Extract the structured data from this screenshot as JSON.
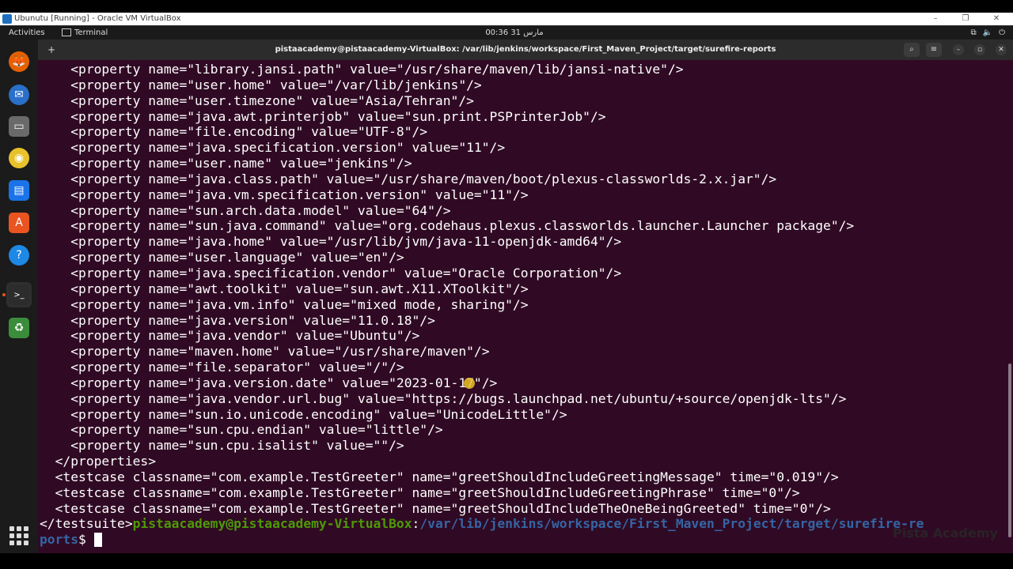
{
  "vbox": {
    "title": "Ubunutu [Running] - Oracle VM VirtualBox",
    "minimize": "–",
    "maximize": "❐",
    "close": "✕"
  },
  "topbar": {
    "activities": "Activities",
    "app_name": "Terminal",
    "clock": "00:36  مارس 31",
    "tray_network": "⧉",
    "tray_volume": "🔈",
    "tray_power": "⏻"
  },
  "dock": {
    "items": [
      {
        "name": "firefox",
        "glyph": "🦊",
        "color": "#e66000"
      },
      {
        "name": "thunderbird",
        "glyph": "✉",
        "color": "#2a6fc9"
      },
      {
        "name": "files",
        "glyph": "▭",
        "color": "#6a6a6a"
      },
      {
        "name": "rhythmbox",
        "glyph": "◉",
        "color": "#e8c22c"
      },
      {
        "name": "writer",
        "glyph": "▤",
        "color": "#1a73e8"
      },
      {
        "name": "software",
        "glyph": "A",
        "color": "#e95420"
      },
      {
        "name": "help",
        "glyph": "?",
        "color": "#1e88e5"
      },
      {
        "name": "terminal",
        "glyph": ">_",
        "color": "#2c2c2c"
      },
      {
        "name": "trash",
        "glyph": "♻",
        "color": "#3b8c3b"
      }
    ]
  },
  "terminal": {
    "title": "pistaacademy@pistaacademy-VirtualBox: /var/lib/jenkins/workspace/First_Maven_Project/target/surefire-reports",
    "new_tab": "+",
    "search": "⌕",
    "menu": "≡",
    "minimize": "–",
    "maximize": "▫",
    "close": "✕",
    "lines": [
      "    <property name=\"library.jansi.path\" value=\"/usr/share/maven/lib/jansi-native\"/>",
      "    <property name=\"user.home\" value=\"/var/lib/jenkins\"/>",
      "    <property name=\"user.timezone\" value=\"Asia/Tehran\"/>",
      "    <property name=\"java.awt.printerjob\" value=\"sun.print.PSPrinterJob\"/>",
      "    <property name=\"file.encoding\" value=\"UTF-8\"/>",
      "    <property name=\"java.specification.version\" value=\"11\"/>",
      "    <property name=\"user.name\" value=\"jenkins\"/>",
      "    <property name=\"java.class.path\" value=\"/usr/share/maven/boot/plexus-classworlds-2.x.jar\"/>",
      "    <property name=\"java.vm.specification.version\" value=\"11\"/>",
      "    <property name=\"sun.arch.data.model\" value=\"64\"/>",
      "    <property name=\"sun.java.command\" value=\"org.codehaus.plexus.classworlds.launcher.Launcher package\"/>",
      "    <property name=\"java.home\" value=\"/usr/lib/jvm/java-11-openjdk-amd64\"/>",
      "    <property name=\"user.language\" value=\"en\"/>",
      "    <property name=\"java.specification.vendor\" value=\"Oracle Corporation\"/>",
      "    <property name=\"awt.toolkit\" value=\"sun.awt.X11.XToolkit\"/>",
      "    <property name=\"java.vm.info\" value=\"mixed mode, sharing\"/>",
      "    <property name=\"java.version\" value=\"11.0.18\"/>",
      "    <property name=\"java.vendor\" value=\"Ubuntu\"/>",
      "    <property name=\"maven.home\" value=\"/usr/share/maven\"/>",
      "    <property name=\"file.separator\" value=\"/\"/>",
      "    <property name=\"java.version.date\" value=\"2023-01-17\"/>",
      "    <property name=\"java.vendor.url.bug\" value=\"https://bugs.launchpad.net/ubuntu/+source/openjdk-lts\"/>",
      "    <property name=\"sun.io.unicode.encoding\" value=\"UnicodeLittle\"/>",
      "    <property name=\"sun.cpu.endian\" value=\"little\"/>",
      "    <property name=\"sun.cpu.isalist\" value=\"\"/>",
      "  </properties>",
      "  <testcase classname=\"com.example.TestGreeter\" name=\"greetShouldIncludeGreetingMessage\" time=\"0.019\"/>",
      "  <testcase classname=\"com.example.TestGreeter\" name=\"greetShouldIncludeGreetingPhrase\" time=\"0\"/>",
      "  <testcase classname=\"com.example.TestGreeter\" name=\"greetShouldIncludeTheOneBeingGreeted\" time=\"0\"/>"
    ],
    "prompt_prefix": "</testsuite>",
    "prompt_user": "pistaacademy@pistaacademy-VirtualBox",
    "prompt_sep": ":",
    "prompt_path_1": "/var/lib/jenkins/workspace/First_Maven_Project/target/surefire-re",
    "prompt_path_2": "ports",
    "prompt_symbol": "$ "
  },
  "watermark": "Pista Academy"
}
